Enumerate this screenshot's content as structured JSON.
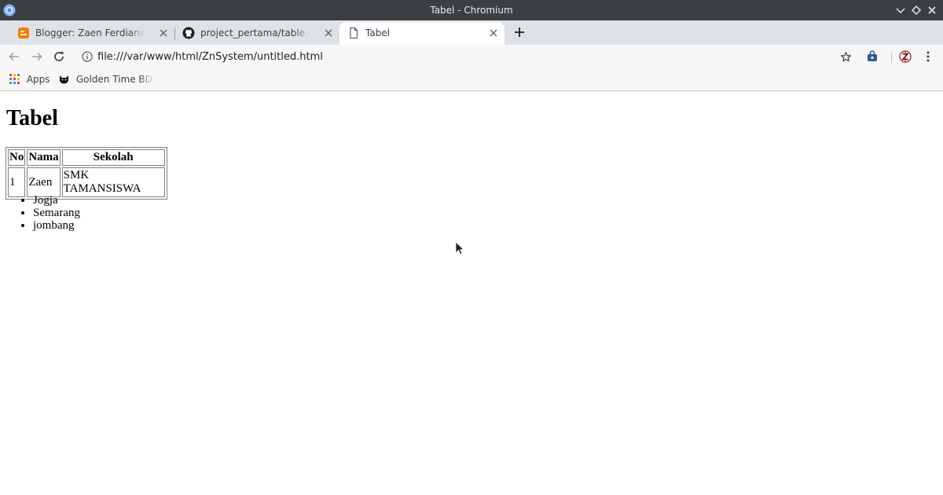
{
  "window": {
    "title": "Tabel - Chromium"
  },
  "tabs": [
    {
      "label": "Blogger: Zaen Ferdiansyah - A",
      "icon": "blogger-icon",
      "active": false
    },
    {
      "label": "project_pertama/table.html a",
      "icon": "github-icon",
      "active": false
    },
    {
      "label": "Tabel",
      "icon": "document-icon",
      "active": true
    }
  ],
  "toolbar": {
    "url": "file:///var/www/html/ZnSystem/untitled.html"
  },
  "bookmarks": [
    {
      "label": "Apps",
      "icon": "apps-grid-icon"
    },
    {
      "label": "Golden Time BD (E",
      "icon": "cat-icon"
    }
  ],
  "page": {
    "heading": "Tabel",
    "table": {
      "headers": [
        "No",
        "Nama",
        "Sekolah"
      ],
      "rows": [
        [
          "1",
          "Zaen",
          "SMK TAMANSISWA"
        ]
      ]
    },
    "list": [
      "Jogja",
      "Semarang",
      "jombang"
    ]
  },
  "colors": {
    "titlebar": "#3b3f43",
    "tabstrip": "#dee1e6",
    "toolbar": "#f7f7f8",
    "blogger": "#f57d00"
  }
}
